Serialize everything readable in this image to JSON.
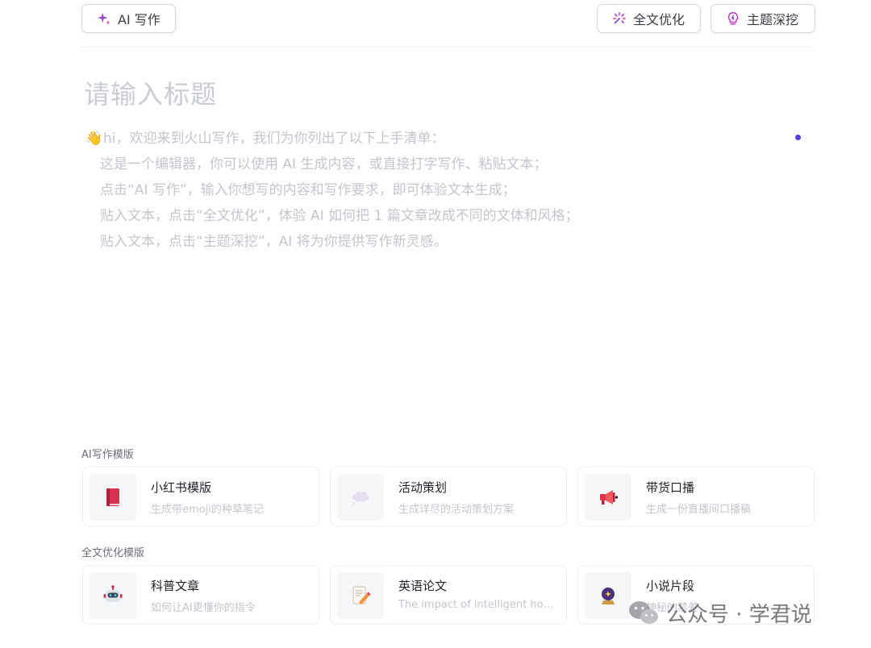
{
  "toolbar": {
    "ai_write": "AI 写作",
    "full_optimize": "全文优化",
    "topic_explore": "主题深挖"
  },
  "editor": {
    "title_placeholder": "请输入标题",
    "guide_lines": [
      "hi，欢迎来到火山写作，我们为你列出了以下上手清单：",
      "这是一个编辑器，你可以使用 AI 生成内容，或直接打字写作、粘贴文本；",
      "点击“AI 写作”，输入你想写的内容和写作要求，即可体验文本生成；",
      "贴入文本，点击“全文优化”，体验 AI 如何把 1 篇文章改成不同的文体和风格；",
      "贴入文本，点击“主题深挖”，AI 将为你提供写作新灵感。"
    ]
  },
  "templates": {
    "ai_section_label": "AI写作模版",
    "opt_section_label": "全文优化模版",
    "cards": [
      {
        "title": "小红书模版",
        "desc": "生成带emoji的种草笔记",
        "icon": "red-book-icon"
      },
      {
        "title": "活动策划",
        "desc": "生成详尽的活动策划方案",
        "icon": "thought-cloud-icon"
      },
      {
        "title": "带货口播",
        "desc": "生成一份直播间口播稿",
        "icon": "megaphone-icon"
      },
      {
        "title": "科普文章",
        "desc": "如何让AI更懂你的指令",
        "icon": "robot-icon"
      },
      {
        "title": "英语论文",
        "desc": "The impact of intelligent house…",
        "icon": "memo-pencil-icon"
      },
      {
        "title": "小说片段",
        "desc": "神秘的禁差",
        "icon": "crystal-ball-icon"
      }
    ]
  },
  "watermark": {
    "text": "公众号 · 学君说"
  },
  "colors": {
    "accent": "#5b3be8",
    "placeholder": "#c3c6cd"
  }
}
